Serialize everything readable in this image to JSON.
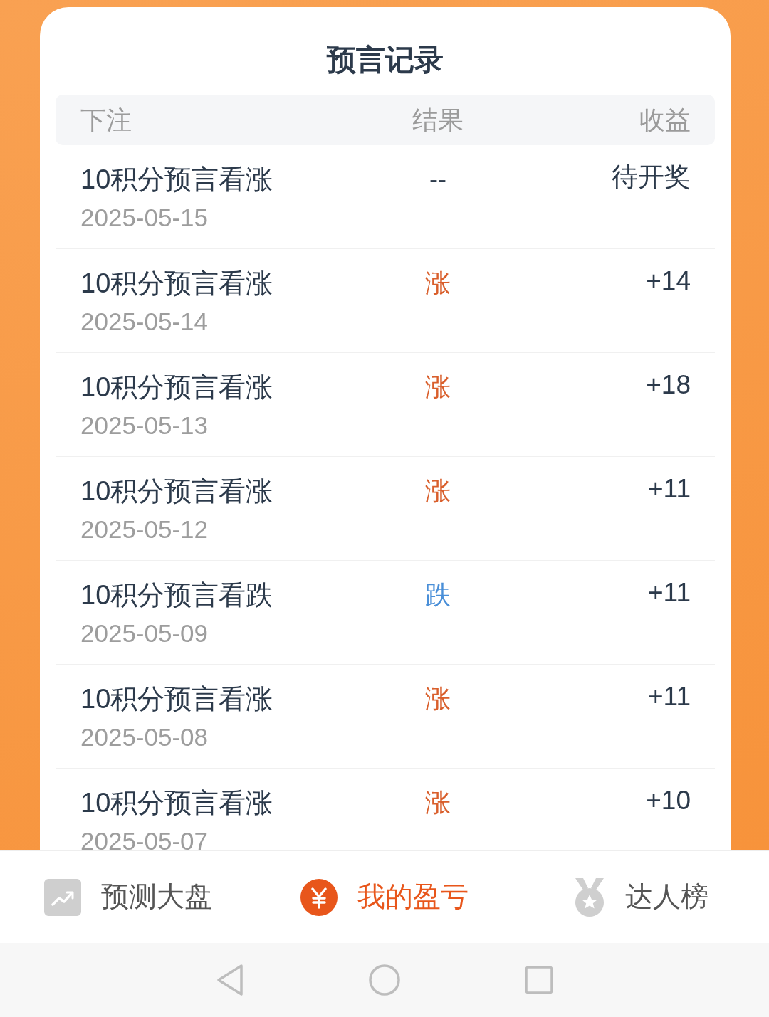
{
  "title": "预言记录",
  "table": {
    "columns": [
      "下注",
      "结果",
      "收益"
    ],
    "rows": [
      {
        "bet": "10积分预言看涨",
        "date": "2025-05-15",
        "result": {
          "text": "--",
          "color": "#2c3a4b"
        },
        "profit": "待开奖"
      },
      {
        "bet": "10积分预言看涨",
        "date": "2025-05-14",
        "result": {
          "text": "涨",
          "color": "#d95f2c"
        },
        "profit": "+14"
      },
      {
        "bet": "10积分预言看涨",
        "date": "2025-05-13",
        "result": {
          "text": "涨",
          "color": "#d95f2c"
        },
        "profit": "+18"
      },
      {
        "bet": "10积分预言看涨",
        "date": "2025-05-12",
        "result": {
          "text": "涨",
          "color": "#d95f2c"
        },
        "profit": "+11"
      },
      {
        "bet": "10积分预言看跌",
        "date": "2025-05-09",
        "result": {
          "text": "跌",
          "color": "#4a8fd8"
        },
        "profit": "+11"
      },
      {
        "bet": "10积分预言看涨",
        "date": "2025-05-08",
        "result": {
          "text": "涨",
          "color": "#d95f2c"
        },
        "profit": "+11"
      },
      {
        "bet": "10积分预言看涨",
        "date": "2025-05-07",
        "result": {
          "text": "涨",
          "color": "#d95f2c"
        },
        "profit": "+10"
      }
    ]
  },
  "tab_bar": {
    "tabs": [
      {
        "label": "预测大盘",
        "selected": false
      },
      {
        "label": "我的盈亏",
        "selected": true
      },
      {
        "label": "达人榜",
        "selected": false
      }
    ]
  }
}
